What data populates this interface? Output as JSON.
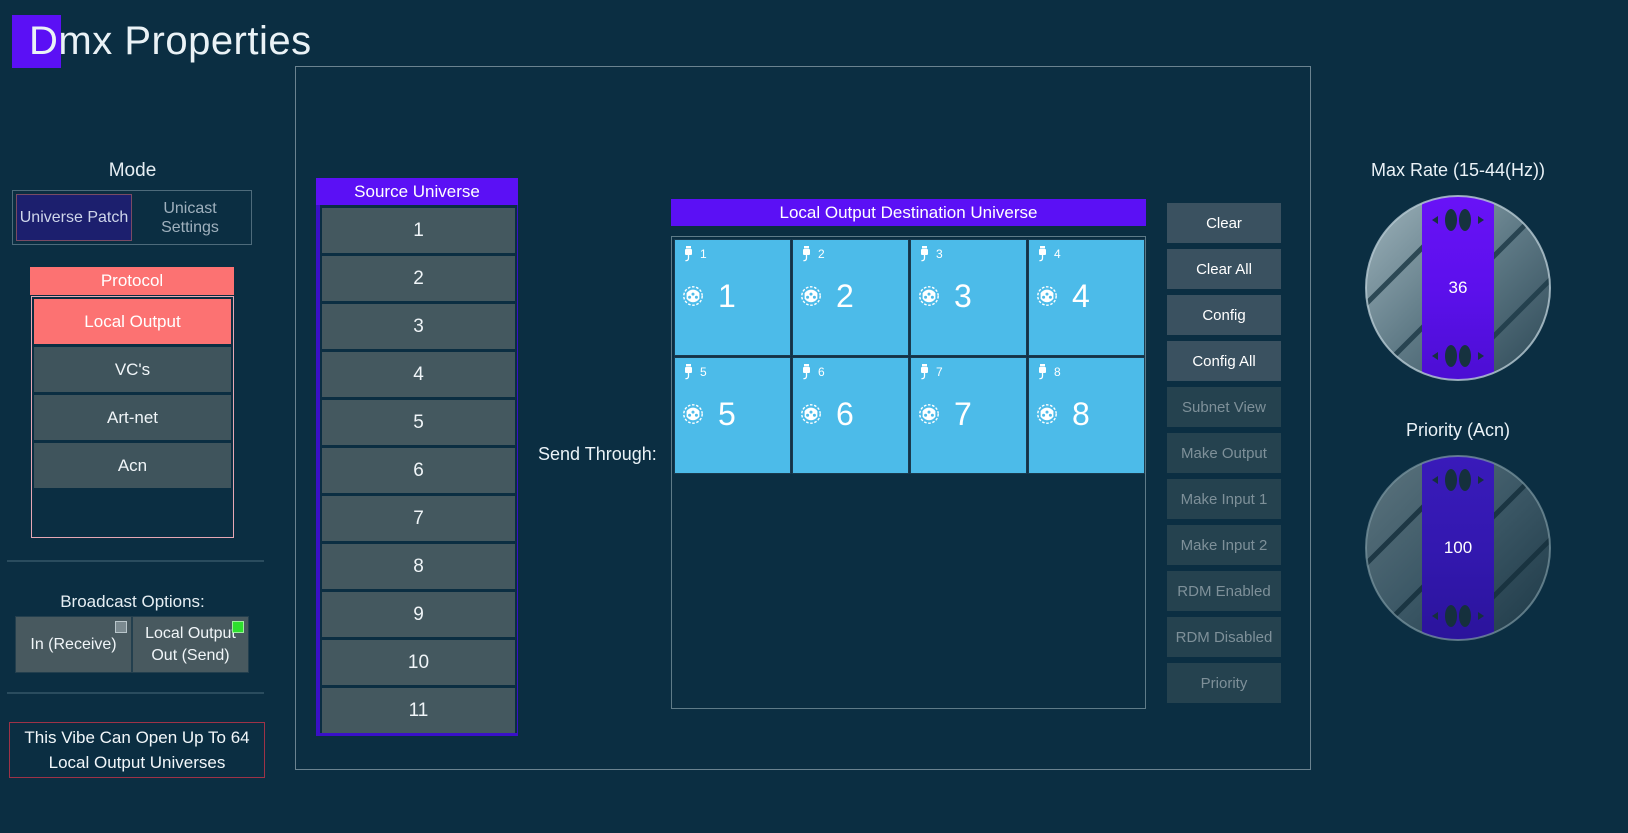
{
  "window": {
    "title": "Dmx Properties",
    "title_badge_letter": "D"
  },
  "left": {
    "mode_label": "Mode",
    "mode_buttons": [
      {
        "label": "Universe Patch",
        "selected": true
      },
      {
        "label": "Unicast Settings",
        "selected": false
      }
    ],
    "protocol_header": "Protocol",
    "protocols": [
      {
        "label": "Local Output",
        "selected": true
      },
      {
        "label": "VC's",
        "selected": false
      },
      {
        "label": "Art-net",
        "selected": false
      },
      {
        "label": "Acn",
        "selected": false
      }
    ],
    "broadcast_label": "Broadcast Options:",
    "broadcast_options": [
      {
        "label": "In (Receive)",
        "indicator": "off"
      },
      {
        "label": "Local Output Out (Send)",
        "indicator": "on"
      }
    ],
    "vibe_note": "This Vibe Can Open Up To 64 Local Output Universes"
  },
  "source_universe": {
    "header": "Source Universe",
    "items": [
      "1",
      "2",
      "3",
      "4",
      "5",
      "6",
      "7",
      "8",
      "9",
      "10",
      "11"
    ]
  },
  "send_through_label": "Send Through:",
  "destination": {
    "header": "Local Output Destination Universe",
    "tiles": [
      {
        "port": "1",
        "universe": "1"
      },
      {
        "port": "2",
        "universe": "2"
      },
      {
        "port": "3",
        "universe": "3"
      },
      {
        "port": "4",
        "universe": "4"
      },
      {
        "port": "5",
        "universe": "5"
      },
      {
        "port": "6",
        "universe": "6"
      },
      {
        "port": "7",
        "universe": "7"
      },
      {
        "port": "8",
        "universe": "8"
      }
    ],
    "plug_icon": "plug-cable-icon",
    "dmx_icon": "dmx-connector-icon"
  },
  "actions": [
    {
      "label": "Clear",
      "enabled": true
    },
    {
      "label": "Clear All",
      "enabled": true
    },
    {
      "label": "Config",
      "enabled": true
    },
    {
      "label": "Config All",
      "enabled": true
    },
    {
      "label": "Subnet View",
      "enabled": false
    },
    {
      "label": "Make Output",
      "enabled": false
    },
    {
      "label": "Make Input 1",
      "enabled": false
    },
    {
      "label": "Make Input 2",
      "enabled": false
    },
    {
      "label": "RDM Enabled",
      "enabled": false
    },
    {
      "label": "RDM Disabled",
      "enabled": false
    },
    {
      "label": "Priority",
      "enabled": false
    }
  ],
  "knobs": [
    {
      "label": "Max Rate (15-44(Hz))",
      "value": "36",
      "enabled": true
    },
    {
      "label": "Priority (Acn)",
      "value": "100",
      "enabled": false
    }
  ],
  "colors": {
    "background": "#0b2e42",
    "accent_purple": "#5b10f5",
    "accent_red": "#fc7272",
    "tile_blue": "#4cbbe9",
    "indicator_green": "#2ee02e"
  }
}
